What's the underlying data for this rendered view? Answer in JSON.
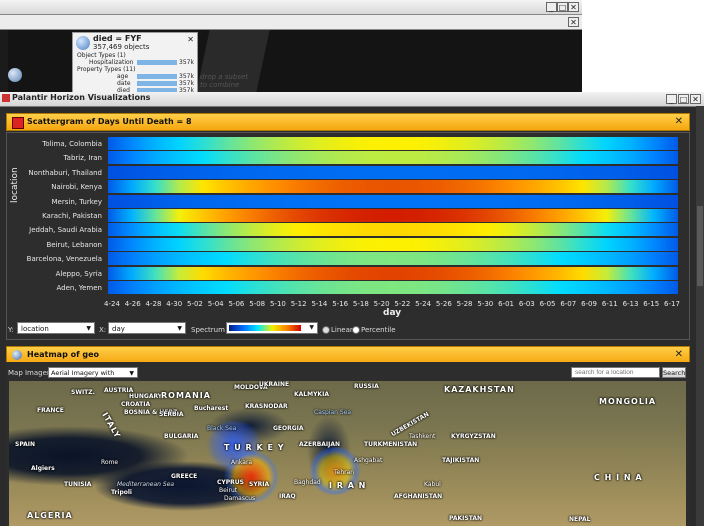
{
  "back_window": {
    "object_card": {
      "title": "died = FYF",
      "count": "357,469 objects",
      "section1": "Object Types (1)",
      "row1_label": "Hospitalization",
      "row1_value": "357k",
      "section2": "Property Types (11)",
      "rows": [
        {
          "label": "age",
          "value": "357k"
        },
        {
          "label": "date",
          "value": "357k"
        },
        {
          "label": "died",
          "value": "357k"
        }
      ]
    },
    "hint": "drop a subset to combine"
  },
  "main_window": {
    "title": "Palantir Horizon Visualizations"
  },
  "scattergram": {
    "title": "Scattergram of Days Until Death = 8",
    "y_axis_label": "location",
    "x_axis_label": "day",
    "locations": [
      "Tolima, Colombia",
      "Tabriz, Iran",
      "Nonthaburi, Thailand",
      "Nairobi, Kenya",
      "Mersin, Turkey",
      "Karachi, Pakistan",
      "Jeddah, Saudi Arabia",
      "Beirut, Lebanon",
      "Barcelona, Venezuela",
      "Aleppo, Syria",
      "Aden, Yemen"
    ],
    "days": [
      "4-24",
      "4-26",
      "4-28",
      "4-30",
      "5-02",
      "5-04",
      "5-06",
      "5-08",
      "5-10",
      "5-12",
      "5-14",
      "5-16",
      "5-18",
      "5-20",
      "5-22",
      "5-24",
      "5-26",
      "5-28",
      "5-30",
      "6-01",
      "6-03",
      "6-05",
      "6-07",
      "6-09",
      "6-11",
      "6-13",
      "6-15",
      "6-17"
    ],
    "row_intensity": [
      0.55,
      0.5,
      0.1,
      0.85,
      0.12,
      0.95,
      0.6,
      0.55,
      0.45,
      0.88,
      0.45
    ],
    "controls": {
      "y_label": "Y:",
      "y_value": "location",
      "x_label": "X:",
      "x_value": "day",
      "spectrum_label": "Spectrum",
      "linear_label": "Linear",
      "percentile_label": "Percentile"
    }
  },
  "heatmap": {
    "title": "Heatmap of geo",
    "map_imagery_label": "Map Imagery:",
    "map_imagery_value": "Aerial Imagery with Labels",
    "search_placeholder": "search for a location",
    "search_button": "Search",
    "map_labels": {
      "france": "FRANCE",
      "switz": "SWITZ.",
      "austria": "AUSTRIA",
      "hungary": "HUNGARY",
      "romania": "ROMANIA",
      "moldova": "MOLDOVA",
      "ukraine": "UKRAINE",
      "russia": "RUSSIA",
      "mongolia": "MONGOLIA",
      "croatia": "CROATIA",
      "bosnia": "BOSNIA &\nHERZ.",
      "serbia": "SERBIA",
      "bulgaria": "BULGARIA",
      "bucharest": "Bucharest",
      "kalmykia": "KALMYKIA",
      "krasnodar": "KRASNODAR",
      "kazakhstan": "KAZAKHSTAN",
      "italy": "ITALY",
      "spain": "SPAIN",
      "greece": "GREECE",
      "turkey": "T U R K E Y",
      "georgia": "GEORGIA",
      "azerbaijan": "AZERBAIJAN",
      "uzbekistan": "UZBEKISTAN",
      "turkmenistan": "TURKMENISTAN",
      "kyrgyzstan": "KYRGYZSTAN",
      "tajikistan": "TAJIKISTAN",
      "china": "C H I N A",
      "algeria": "ALGERIA",
      "tunisia": "TUNISIA",
      "algiers": "Algiers",
      "tripoli": "Tripoli",
      "cyprus": "CYPRUS",
      "syria": "SYRIA",
      "iran": "I R A N",
      "iraq": "IRAQ",
      "afghanistan": "AFGHANISTAN",
      "pakistan": "PAKISTAN",
      "nepal": "NEPAL",
      "black_sea": "Black Sea",
      "med_sea": "Mediterranean Sea",
      "caspian": "Caspian\nSea",
      "ankara": "Ankara",
      "tehran": "Tehran",
      "baghdad": "Baghdad",
      "kabul": "Kabul",
      "damascus": "Damascus",
      "beirut": "Beirut",
      "tashkent": "Tashkent",
      "rome": "Rome",
      "ashgabat": "Ashgabat"
    }
  },
  "colors": {
    "panel_header": "#f5a60e",
    "cold": "#0050ff",
    "hot": "#d00000"
  }
}
